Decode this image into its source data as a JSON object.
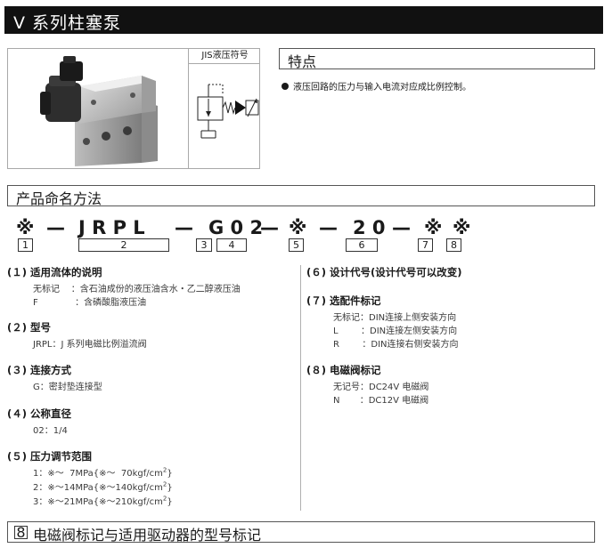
{
  "page_title": "V 系列柱塞泵",
  "jis_label": "JIS液压符号",
  "features": {
    "title": "特点",
    "bullet": "液压回路的压力与输入电流对应成比例控制。"
  },
  "naming": {
    "title": "产品命名方法",
    "code_segments": [
      "※",
      "—",
      "J R P L",
      "—",
      "G 0 2",
      "—",
      "※",
      "—",
      "2 0",
      "—",
      "※",
      "※"
    ],
    "position_numbers": [
      "1",
      "2",
      "3",
      "4",
      "5",
      "6",
      "7",
      "8"
    ]
  },
  "items": [
    {
      "heading": "(１)  适用流体的说明",
      "lines": [
        "无标记    ：含石油成份的液压油含水・乙二醇液压油",
        "F             ：含磷酸脂液压油"
      ]
    },
    {
      "heading": "(２)  型号",
      "lines": [
        "JRPL：J 系列电磁比例溢流阀"
      ]
    },
    {
      "heading": "(３)  连接方式",
      "lines": [
        "G：密封垫连接型"
      ]
    },
    {
      "heading": "(４)  公称直径",
      "lines": [
        "02：1/4"
      ]
    },
    {
      "heading": "(５)  压力调节范围",
      "lines": [
        {
          "text": "1：※～  7MPa{※～  70kgf/cm",
          "sup": "2",
          "tail": "}"
        },
        {
          "text": "2：※～14MPa{※～140kgf/cm",
          "sup": "2",
          "tail": "}"
        },
        {
          "text": "3：※～21MPa{※～210kgf/cm",
          "sup": "2",
          "tail": "}"
        }
      ]
    },
    {
      "heading": "(６)  设计代号(设计代号可以改变)",
      "lines": []
    },
    {
      "heading": "(７)  选配件标记",
      "lines": [
        "无标记：DIN连接上侧安装方向",
        "L        ：DIN连接左侧安装方向",
        "R        ：DIN连接右侧安装方向"
      ]
    },
    {
      "heading": "(８)  电磁阀标记",
      "lines": [
        "无记号：DC24V 电磁阀",
        "N       ：DC12V 电磁阀"
      ]
    }
  ],
  "bottom_section": {
    "badge": "8",
    "title": "电磁阀标记与适用驱动器的型号标记"
  }
}
